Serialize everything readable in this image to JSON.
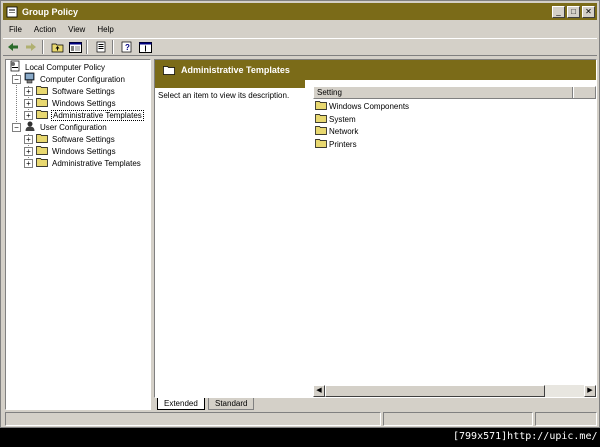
{
  "window": {
    "title": "Group Policy",
    "controls": [
      "_",
      "□",
      "✕"
    ]
  },
  "menu": [
    "File",
    "Action",
    "View",
    "Help"
  ],
  "tree": {
    "root": "Local Computer Policy",
    "computer_config": "Computer Configuration",
    "computer_children": [
      "Software Settings",
      "Windows Settings",
      "Administrative Templates"
    ],
    "user_config": "User Configuration",
    "user_children": [
      "Software Settings",
      "Windows Settings",
      "Administrative Templates"
    ]
  },
  "details": {
    "header_title": "Administrative Templates",
    "description": "Select an item to view its description.",
    "column": "Setting",
    "items": [
      "Windows Components",
      "System",
      "Network",
      "Printers"
    ]
  },
  "tabs": [
    "Extended",
    "Standard"
  ],
  "watermark": "[799x571]http://upic.me/",
  "colors": {
    "titlebar": "#7b6b18",
    "folder": "#e8d870",
    "face": "#d4d0c8"
  }
}
